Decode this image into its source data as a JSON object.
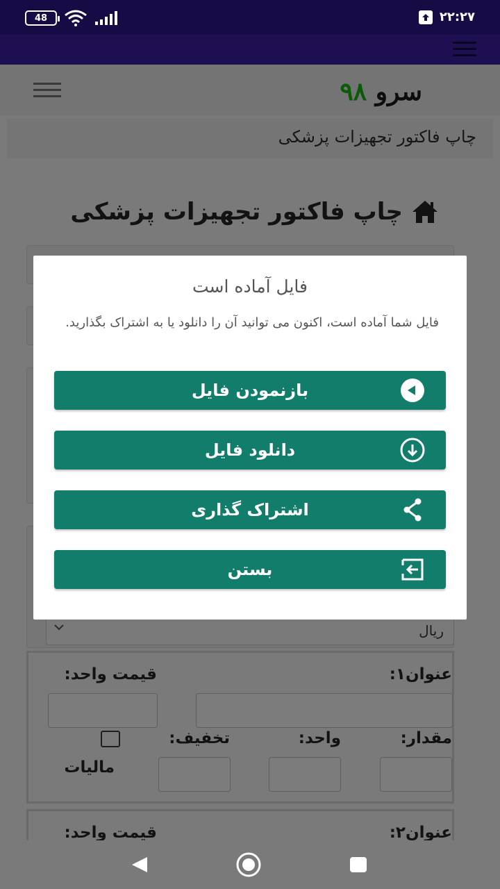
{
  "status_bar": {
    "battery": "48",
    "time": "۲۲:۲۷"
  },
  "header": {
    "logo_text": "سرو",
    "logo_number": "۹۸"
  },
  "breadcrumb": "چاپ فاکتور تجهیزات پزشکی",
  "page_title": "چاپ فاکتور تجهیزات پزشکی",
  "currency": {
    "selected": "ریال"
  },
  "items": [
    {
      "title_label": "عنوان۱:",
      "price_label": "قیمت واحد:",
      "qty_label": "مقدار:",
      "unit_label": "واحد:",
      "discount_label": "تخفیف:",
      "tax_label": "مالیات"
    },
    {
      "title_label": "عنوان۲:",
      "price_label": "قیمت واحد:"
    }
  ],
  "modal": {
    "title": "فایل آماده است",
    "message": "فایل شما آماده است، اکنون می توانید آن را دانلود یا به اشتراک بگذارید.",
    "buttons": [
      {
        "label": "بازنمودن فایل",
        "icon": "play-circle-icon"
      },
      {
        "label": "دانلود فایل",
        "icon": "download-circle-icon"
      },
      {
        "label": "اشتراک گذاری",
        "icon": "share-icon"
      },
      {
        "label": "بستن",
        "icon": "exit-icon"
      }
    ]
  },
  "colors": {
    "status_bar": "#170b45",
    "app_bar": "#1e0e52",
    "accent": "#127d6b",
    "logo_number": "#0a5a08"
  }
}
